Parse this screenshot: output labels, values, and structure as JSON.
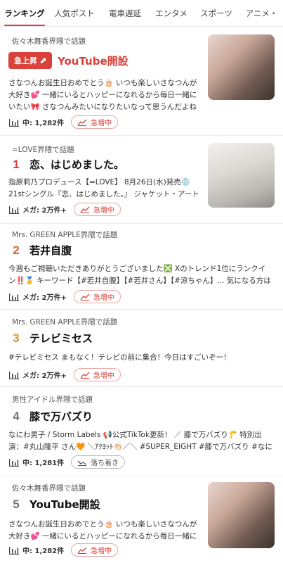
{
  "tabs": [
    "ランキング",
    "人気ポスト",
    "電車遅延",
    "エンタメ",
    "スポーツ",
    "アニメ・"
  ],
  "items": [
    {
      "source": "佐々木舞香界隈で話題",
      "badge": "急上昇",
      "title": "YouTube開設",
      "desc": "さなつんお誕生日おめでとう🎂 いつも楽しいさなつんが大好き💕 一緒にいるとハッピーになれるから毎日一緒にいたい🎀 さなつんみたいになりたいなって思うんだよね🌕 良い…",
      "count": "中: 1,282件",
      "status": "急増中"
    },
    {
      "source": "=LOVE界隈で話題",
      "rank": "1",
      "title": "恋、はじめました。",
      "desc": "指原莉乃プロデュース【=LOVE】 8月26日(水)発売💿 21stシングル『恋、はじめました。』 ジャケット・アートワーク…",
      "count": "メガ: 2万件+",
      "status": "急増中"
    },
    {
      "source": "Mrs. GREEN APPLE界隈で話題",
      "rank": "2",
      "title": "若井自腹",
      "desc": "今週もご視聴いただきありがとうございました❎ Xのトレンド1位にランクイン‼️🥇 キーワード【#若井自腹】【#若井さん】【#涼ちゃん】... 気になる方はTVerでもう…",
      "count": "メガ: 2万件+",
      "status": "急増中"
    },
    {
      "source": "Mrs. GREEN APPLE界隈で話題",
      "rank": "3",
      "title": "テレビミセス",
      "desc": "#テレビミセス まもなく！テレビの前に集合！今日はすごいぞー！",
      "count": "メガ: 2万件+",
      "status": "急増中"
    },
    {
      "source": "男性アイドル界隈で話題",
      "rank": "4",
      "title": "膝で万バズり",
      "desc": "なにわ男子 / Storm Labels 📢公式TikTok更新！ ／ 膝で万バズり🦵 特別出演：#丸山隆平 さん🧡 ＼ｱｸﾖｯﾄ👏🏻／＼ #SUPER_EIGHT #膝で万バズり #なにわ男子…",
      "count": "中: 1,281件",
      "status": "落ち着き"
    },
    {
      "source": "佐々木舞香界隈で話題",
      "rank": "5",
      "title": "YouTube開設",
      "desc": "さなつんお誕生日おめでとう🎂 いつも楽しいさなつんが大好き💕 一緒にいるとハッピーになれるから毎日一緒にいたい🎀",
      "count": "中: 1,282件",
      "status": "急増中"
    }
  ]
}
